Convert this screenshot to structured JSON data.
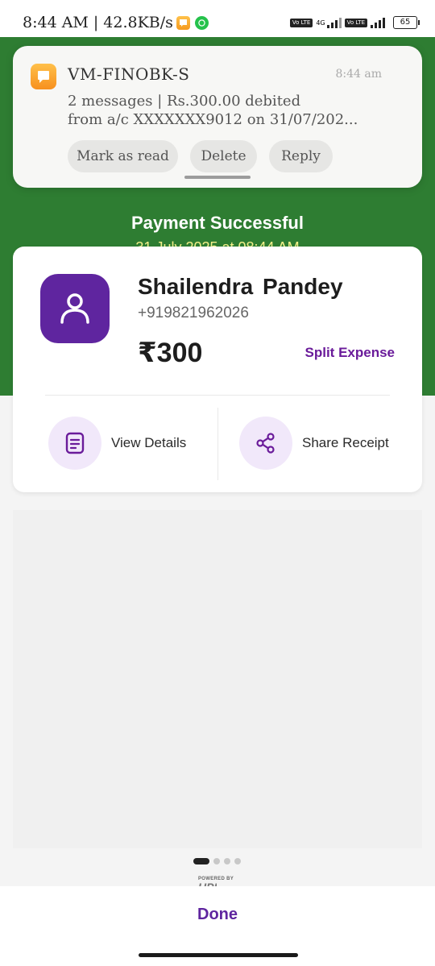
{
  "status_bar": {
    "time": "8:44 AM",
    "separator": "|",
    "net_speed": "42.8KB/s",
    "volte_label": "Vo LTE",
    "network_type": "4G",
    "battery": "65"
  },
  "notification": {
    "sender": "VM-FINOBK-S",
    "time": "8:44 am",
    "line1": "2 messages | Rs.300.00 debited",
    "line2": "from a/c XXXXXXX9012 on 31/07/202...",
    "actions": {
      "mark_read": "Mark as read",
      "delete": "Delete",
      "reply": "Reply"
    }
  },
  "header": {
    "title": "Payment Successful",
    "datetime": "31 July 2025 at 08:44 AM"
  },
  "payee": {
    "name": "Shailendra  Pandey",
    "phone": "+919821962026",
    "amount": "₹300",
    "split_label": "Split Expense"
  },
  "actions": {
    "view_details": "View Details",
    "share_receipt": "Share Receipt"
  },
  "footer": {
    "powered_by": "POWERED BY",
    "upi": "UPI",
    "done": "Done"
  },
  "colors": {
    "header_green": "#2e7d32",
    "brand_purple": "#5f259f",
    "date_yellow": "#f4f08a"
  }
}
